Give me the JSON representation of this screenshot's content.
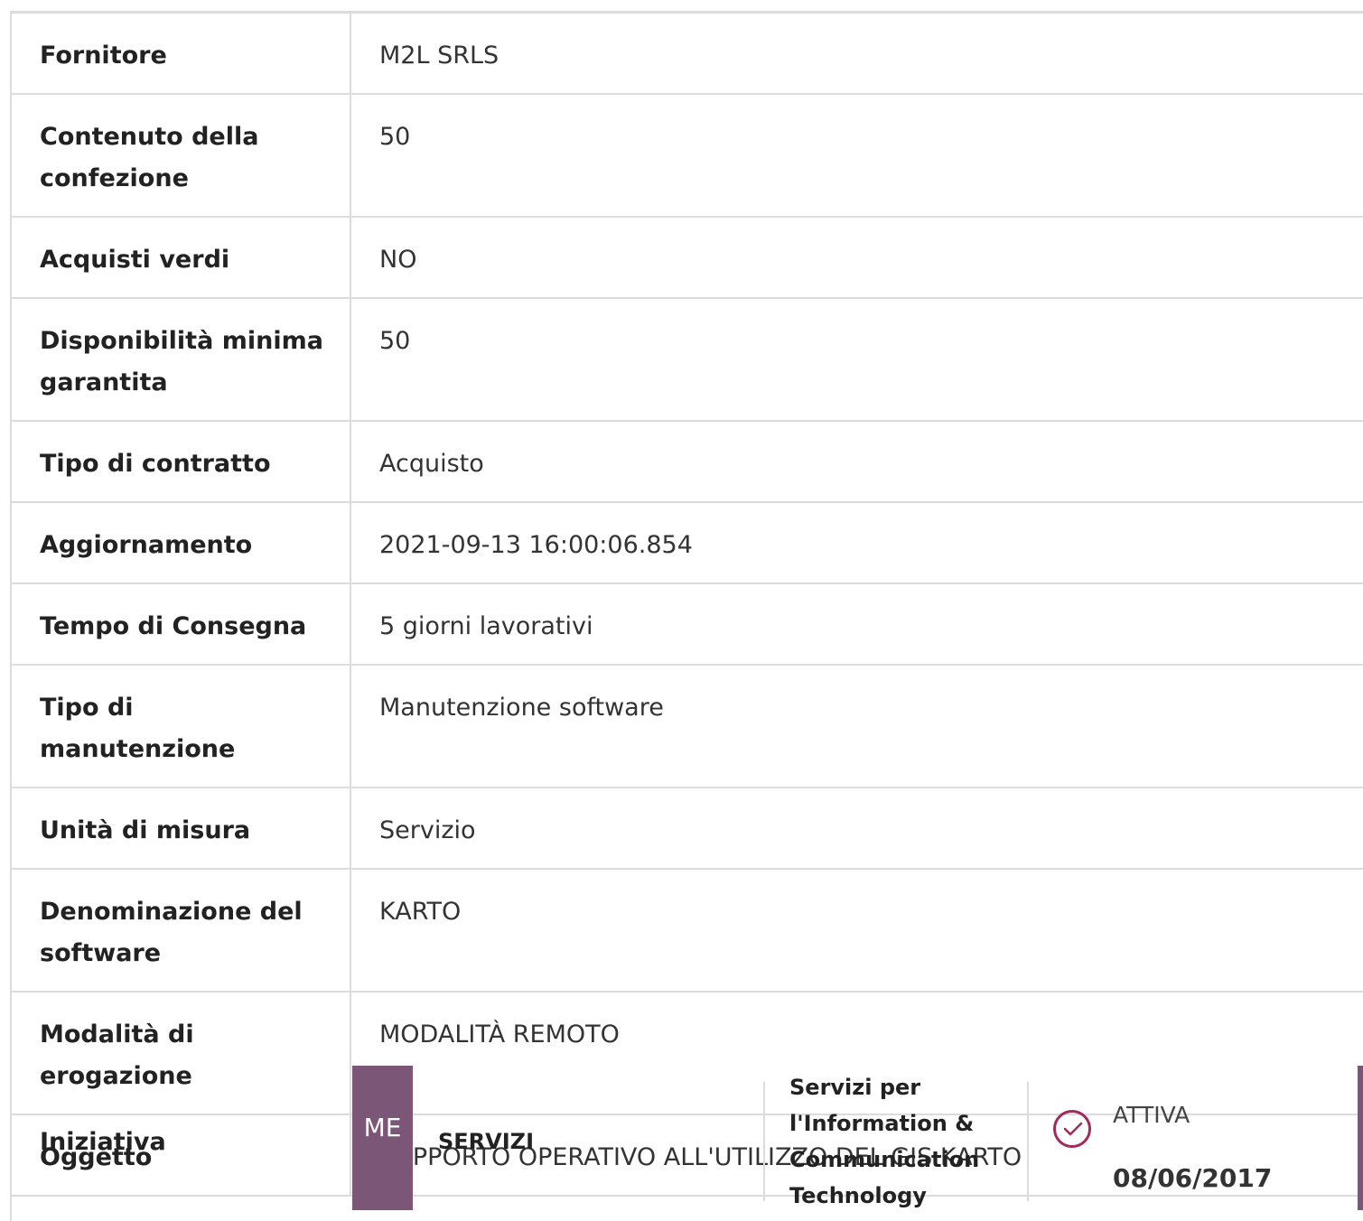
{
  "rows": [
    {
      "label": "Fornitore",
      "value": "M2L SRLS"
    },
    {
      "label": "Contenuto della confezione",
      "value": "50"
    },
    {
      "label": "Acquisti verdi",
      "value": "NO"
    },
    {
      "label": "Disponibilità minima garantita",
      "value": "50"
    },
    {
      "label": "Tipo di contratto",
      "value": "Acquisto"
    },
    {
      "label": "Aggiornamento",
      "value": "2021-09-13 16:00:06.854"
    },
    {
      "label": "Tempo di Consegna",
      "value": "5 giorni lavorativi"
    },
    {
      "label": "Tipo di manutenzione",
      "value": "Manutenzione software"
    },
    {
      "label": "Unità di misura",
      "value": "Servizio"
    },
    {
      "label": "Denominazione del software",
      "value": "KARTO"
    },
    {
      "label": "Modalità di erogazione",
      "value": "MODALITÀ REMOTO"
    },
    {
      "label": "Oggetto",
      "value": "SUPPORTO OPERATIVO ALL'UTILIZZO DEL GIS KARTO"
    }
  ],
  "initiative": {
    "label": "Iniziativa",
    "badge": "ME",
    "type": "SERVIZI",
    "category": "Servizi per l'Information & Communication Technology",
    "status": "ATTIVA",
    "date": "08/06/2017",
    "status_icon": "check-circle-icon",
    "accent_color": "#7b5677",
    "status_color": "#a12a5e"
  }
}
